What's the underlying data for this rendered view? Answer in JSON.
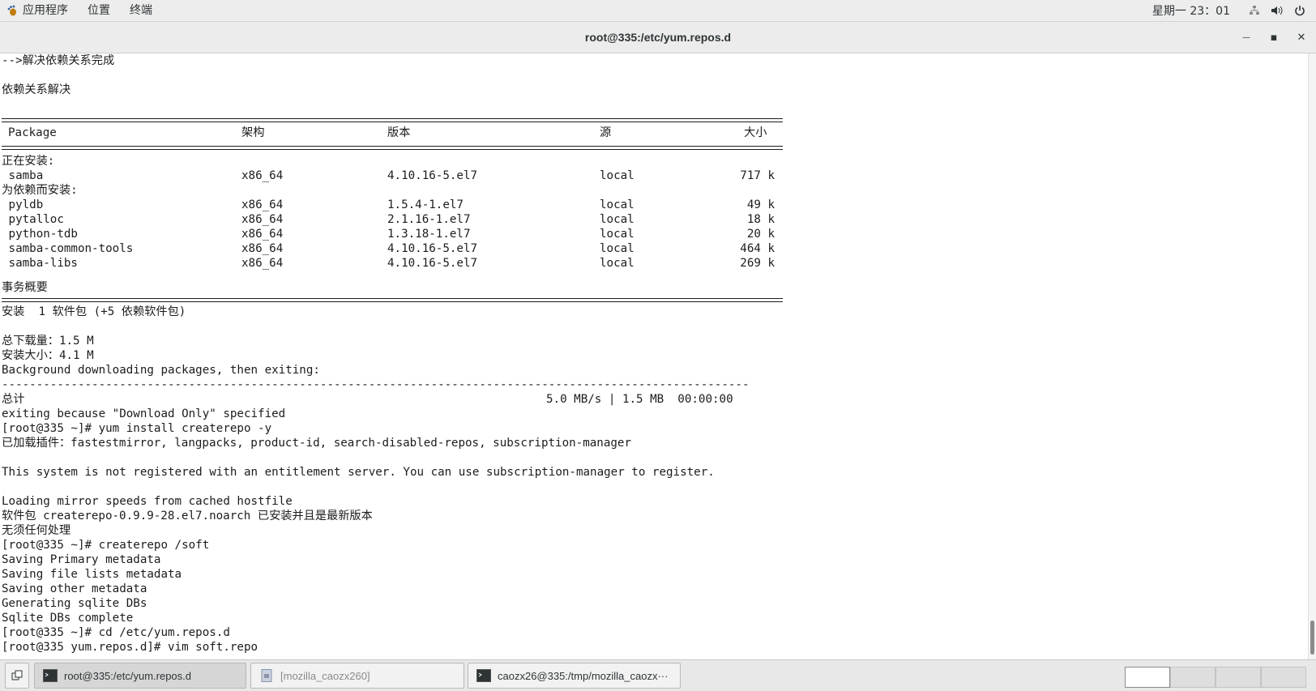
{
  "top_panel": {
    "applications": "应用程序",
    "places": "位置",
    "terminal": "终端",
    "clock": "星期一 23：01"
  },
  "window": {
    "title": "root@335:/etc/yum.repos.d",
    "minimize": "—",
    "maximize": "▪",
    "close": "✕"
  },
  "terminal": {
    "pre_lines": [
      "-->解决依赖关系完成",
      "",
      "依赖关系解决"
    ],
    "table_headers": [
      "Package",
      "架构",
      "版本",
      "源",
      "大小"
    ],
    "installing_label": "正在安装:",
    "installing": [
      {
        "name": " samba",
        "arch": "x86_64",
        "version": "4.10.16-5.el7",
        "repo": "local",
        "size": "717 k"
      }
    ],
    "deps_label": "为依赖而安装:",
    "deps": [
      {
        "name": " pyldb",
        "arch": "x86_64",
        "version": "1.5.4-1.el7",
        "repo": "local",
        "size": "49 k"
      },
      {
        "name": " pytalloc",
        "arch": "x86_64",
        "version": "2.1.16-1.el7",
        "repo": "local",
        "size": "18 k"
      },
      {
        "name": " python-tdb",
        "arch": "x86_64",
        "version": "1.3.18-1.el7",
        "repo": "local",
        "size": "20 k"
      },
      {
        "name": " samba-common-tools",
        "arch": "x86_64",
        "version": "4.10.16-5.el7",
        "repo": "local",
        "size": "464 k"
      },
      {
        "name": " samba-libs",
        "arch": "x86_64",
        "version": "4.10.16-5.el7",
        "repo": "local",
        "size": "269 k"
      }
    ],
    "summary_label": "事务概要",
    "summary_install": "安装  1 软件包 (+5 依赖软件包)",
    "download_size": "总下载量：1.5 M",
    "install_size": "安装大小：4.1 M",
    "bg_download": "Background downloading packages, then exiting:",
    "dash_line": "------------------------------------------------------------------------------------------------------------",
    "total_label": "总计",
    "total_stats": "5.0 MB/s | 1.5 MB  00:00:00",
    "post_lines": [
      "exiting because \"Download Only\" specified",
      "[root@335 ~]# yum install createrepo -y",
      "已加载插件：fastestmirror, langpacks, product-id, search-disabled-repos, subscription-manager",
      "",
      "This system is not registered with an entitlement server. You can use subscription-manager to register.",
      "",
      "Loading mirror speeds from cached hostfile",
      "软件包 createrepo-0.9.9-28.el7.noarch 已安装并且是最新版本",
      "无须任何处理",
      "[root@335 ~]# createrepo /soft",
      "Saving Primary metadata",
      "Saving file lists metadata",
      "Saving other metadata",
      "Generating sqlite DBs",
      "Sqlite DBs complete",
      "[root@335 ~]# cd /etc/yum.repos.d",
      "[root@335 yum.repos.d]# vim soft.repo"
    ]
  },
  "taskbar": {
    "tasks": [
      {
        "label": "root@335:/etc/yum.repos.d",
        "icon": "terminal-icon"
      },
      {
        "label": "[mozilla_caozx260]",
        "icon": "file-manager-icon"
      },
      {
        "label": "caozx26@335:/tmp/mozilla_caozx···",
        "icon": "terminal-icon"
      }
    ]
  }
}
